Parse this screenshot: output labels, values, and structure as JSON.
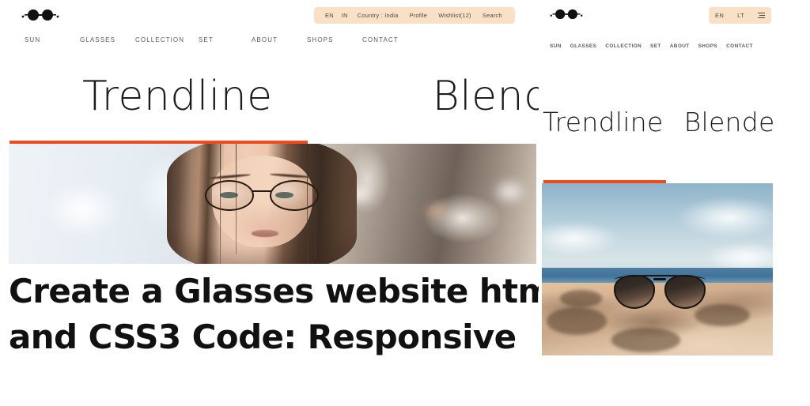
{
  "brand": {
    "logo_icon": "glasses-logo-icon",
    "accent_color": "#f04b1e",
    "pill_color": "#fae1c5",
    "text_color": "#5d5d5d"
  },
  "desktop": {
    "utility_bar": {
      "items": [
        {
          "label": "EN",
          "name": "language-en"
        },
        {
          "label": "IN",
          "name": "region-in"
        },
        {
          "label": "Country : India",
          "name": "country-selector"
        },
        {
          "label": "Profile",
          "name": "profile-link"
        },
        {
          "label": "Wishlist(12)",
          "name": "wishlist-link"
        },
        {
          "label": "Search",
          "name": "search-link"
        }
      ]
    },
    "nav": {
      "items": [
        {
          "label": "SUN",
          "name": "nav-sun"
        },
        {
          "label": "GLASSES",
          "name": "nav-glasses"
        },
        {
          "label": "COLLECTION",
          "name": "nav-collection"
        },
        {
          "label": "SET",
          "name": "nav-set"
        },
        {
          "label": "ABOUT",
          "name": "nav-about"
        },
        {
          "label": "SHOPS",
          "name": "nav-shops"
        },
        {
          "label": "CONTACT",
          "name": "nav-contact"
        }
      ]
    },
    "hero": {
      "word_one": "Trendline",
      "word_two": "Blende"
    },
    "photo_alt": "woman-wearing-round-glasses"
  },
  "tablet": {
    "utility_bar": {
      "language": "EN",
      "secondary": "LT",
      "menu_icon": "hamburger-menu-icon"
    },
    "nav": {
      "items": [
        {
          "label": "SUN",
          "name": "nav-sun"
        },
        {
          "label": "GLASSES",
          "name": "nav-glasses"
        },
        {
          "label": "COLLECTION",
          "name": "nav-collection"
        },
        {
          "label": "SET",
          "name": "nav-set"
        },
        {
          "label": "ABOUT",
          "name": "nav-about"
        },
        {
          "label": "SHOPS",
          "name": "nav-shops"
        },
        {
          "label": "CONTACT",
          "name": "nav-contact"
        }
      ]
    },
    "hero": {
      "word_one": "Trendline",
      "word_two": "Blende"
    },
    "photo_alt": "sunglasses-on-beach-sand"
  },
  "caption": {
    "line_one": "Create a Glasses website html",
    "line_two": "and CSS3 Code: Responsive"
  }
}
